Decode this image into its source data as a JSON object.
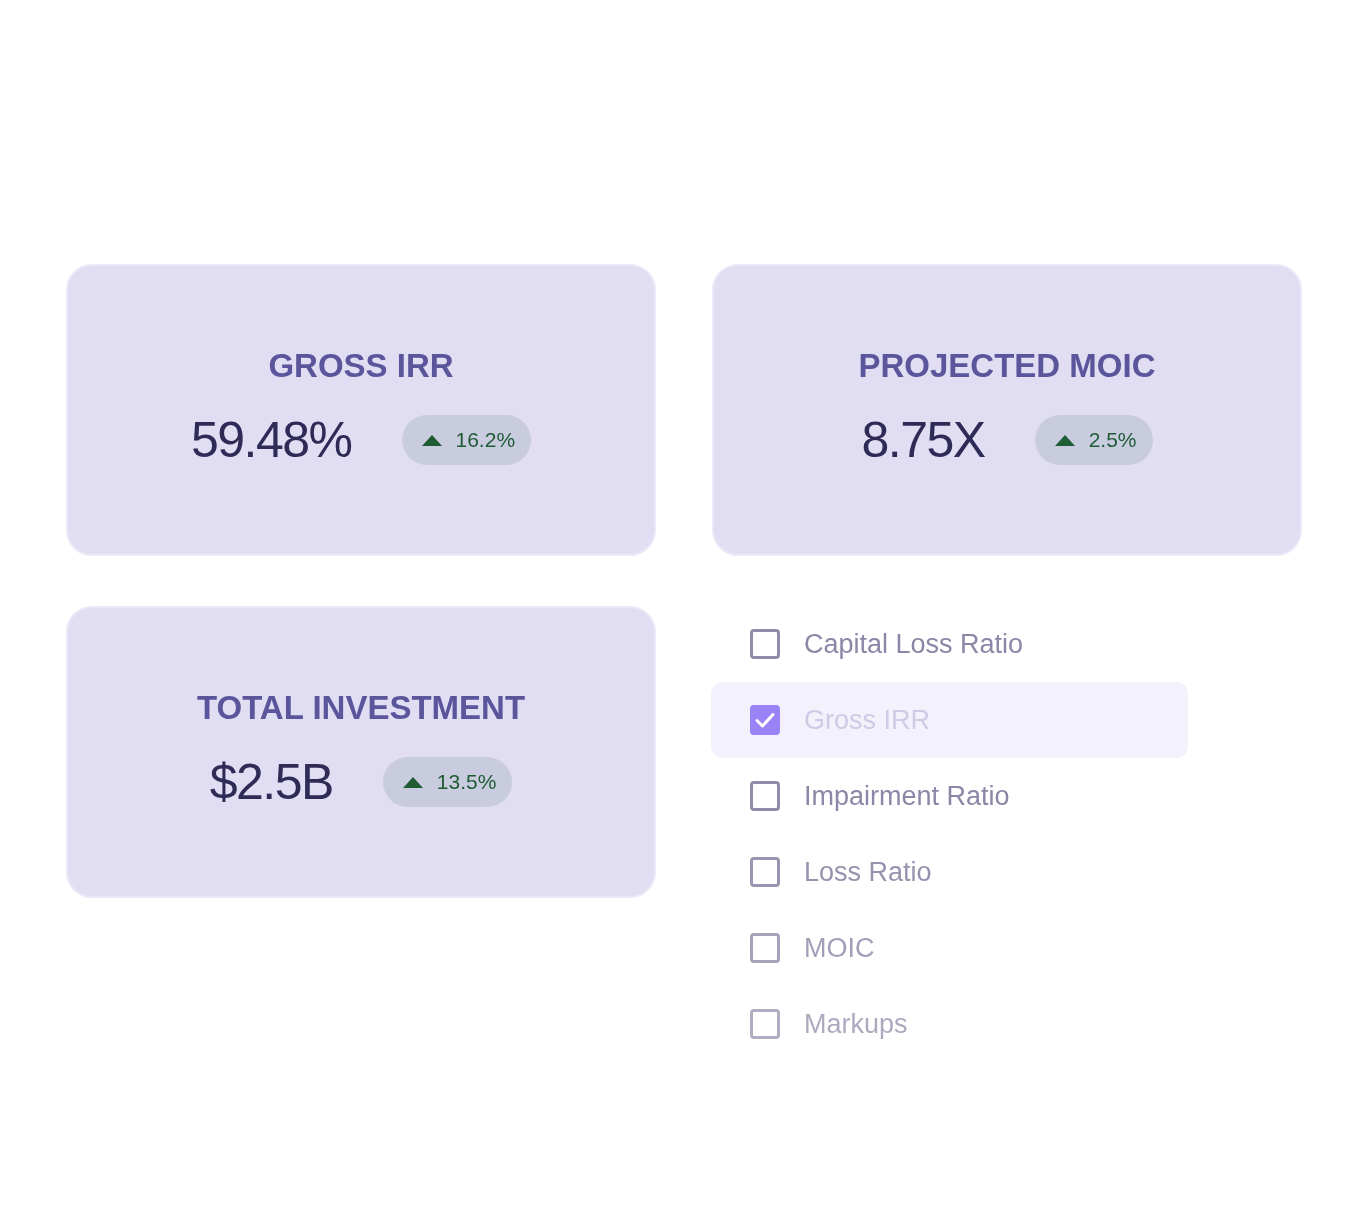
{
  "cards": [
    {
      "title": "GROSS IRR",
      "value": "59.48%",
      "change": {
        "kind": "up",
        "text": "16.2%"
      }
    },
    {
      "title": "PROJECTED MOIC",
      "value": "8.75X",
      "change": {
        "kind": "up",
        "text": "2.5%"
      }
    },
    {
      "title": "TOTAL INVESTMENT",
      "value": "$2.5B",
      "change": {
        "kind": "up",
        "text": "13.5%"
      }
    }
  ],
  "checklist": [
    {
      "label": "Capital Loss Ratio",
      "checked": false,
      "selected": false
    },
    {
      "label": "Gross IRR",
      "checked": true,
      "selected": true
    },
    {
      "label": "Impairment Ratio",
      "checked": false,
      "selected": false
    },
    {
      "label": "Loss Ratio",
      "checked": false,
      "selected": false
    },
    {
      "label": "MOIC",
      "checked": false,
      "selected": false
    },
    {
      "label": "Markups",
      "checked": false,
      "selected": false
    }
  ]
}
